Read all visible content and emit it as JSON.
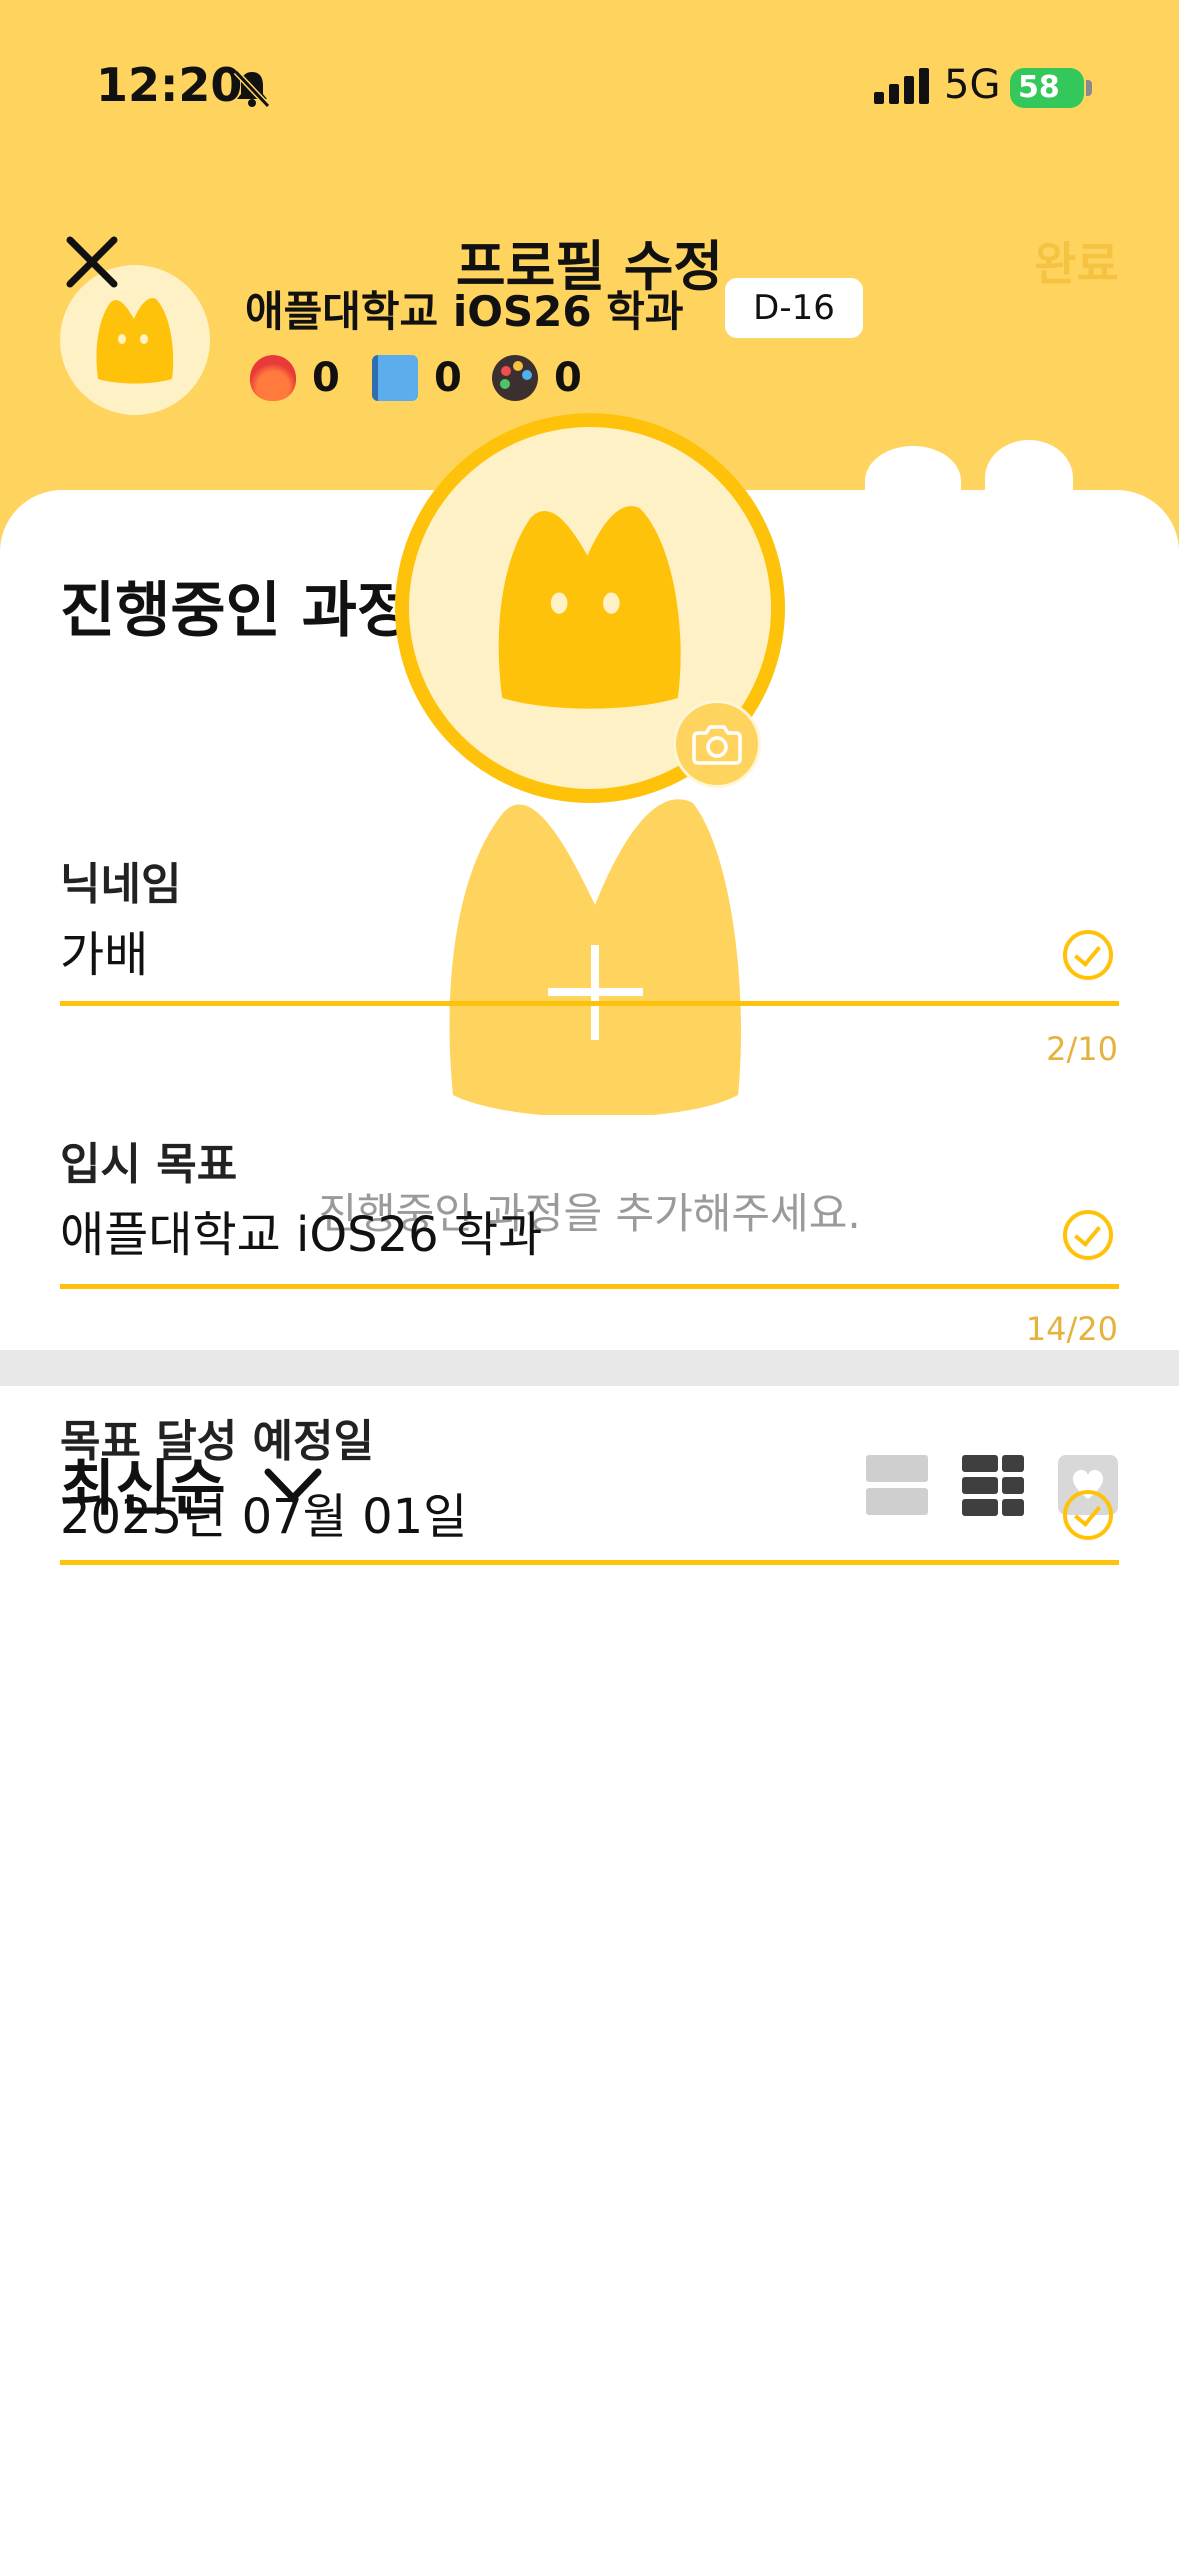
{
  "status_bar": {
    "time": "12:20",
    "network": "5G",
    "battery": "58"
  },
  "background": {
    "school": "애플대학교 iOS26 학과",
    "dday": "D-16",
    "stats": {
      "fire": "0",
      "note": "0",
      "palette": "0"
    },
    "section_title": "진행중인 과정",
    "empty_message": "진행중인 과정을 추가해주세요.",
    "sort_label": "최신순"
  },
  "modal": {
    "title": "프로필 수정",
    "done": "완료",
    "fields": {
      "nickname": {
        "label": "닉네임",
        "value": "가배",
        "counter": "2/10"
      },
      "goal": {
        "label": "입시 목표",
        "value": "애플대학교 iOS26 학과",
        "counter": "14/20"
      },
      "date": {
        "label": "목표 달성 예정일",
        "value": "2025년 07월 01일"
      }
    }
  },
  "colors": {
    "accent": "#FFC20A",
    "header_bg": "#FFD45E",
    "done_text": "#F5C242"
  }
}
